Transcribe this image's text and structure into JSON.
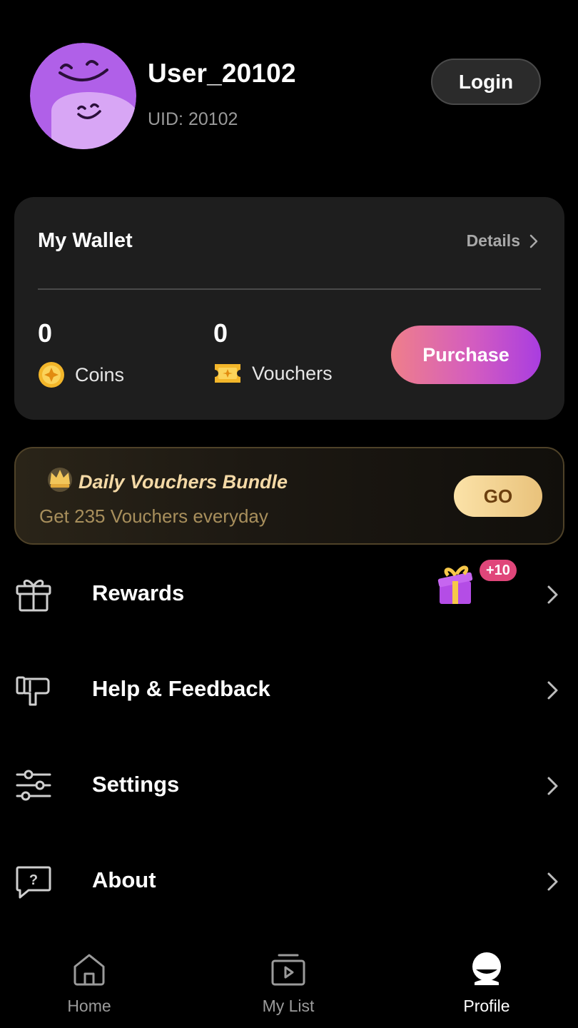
{
  "profile": {
    "username": "User_20102",
    "uid": "UID: 20102",
    "login_label": "Login",
    "avatar_color": "#b060e8"
  },
  "wallet": {
    "title": "My Wallet",
    "details_label": "Details",
    "coins_value": "0",
    "coins_label": "Coins",
    "vouchers_value": "0",
    "vouchers_label": "Vouchers",
    "purchase_label": "Purchase"
  },
  "bundle": {
    "title": "Daily Vouchers Bundle",
    "subtitle": "Get 235 Vouchers everyday",
    "go_label": "GO"
  },
  "menu": {
    "items": [
      {
        "label": "Rewards",
        "icon": "gift-icon"
      },
      {
        "label": "Help & Feedback",
        "icon": "feedback-icon"
      },
      {
        "label": "Settings",
        "icon": "sliders-icon"
      },
      {
        "label": "About",
        "icon": "question-bubble-icon"
      }
    ],
    "rewards_badge": "+10"
  },
  "nav": {
    "items": [
      {
        "label": "Home",
        "icon": "home-icon",
        "active": false
      },
      {
        "label": "My List",
        "icon": "play-list-icon",
        "active": false
      },
      {
        "label": "Profile",
        "icon": "profile-icon",
        "active": true
      }
    ]
  },
  "colors": {
    "background": "#000000",
    "card": "#1e1e1e",
    "accent_gradient": [
      "#ef7f8a",
      "#a93de0"
    ],
    "gold": "#f4d9a6"
  }
}
